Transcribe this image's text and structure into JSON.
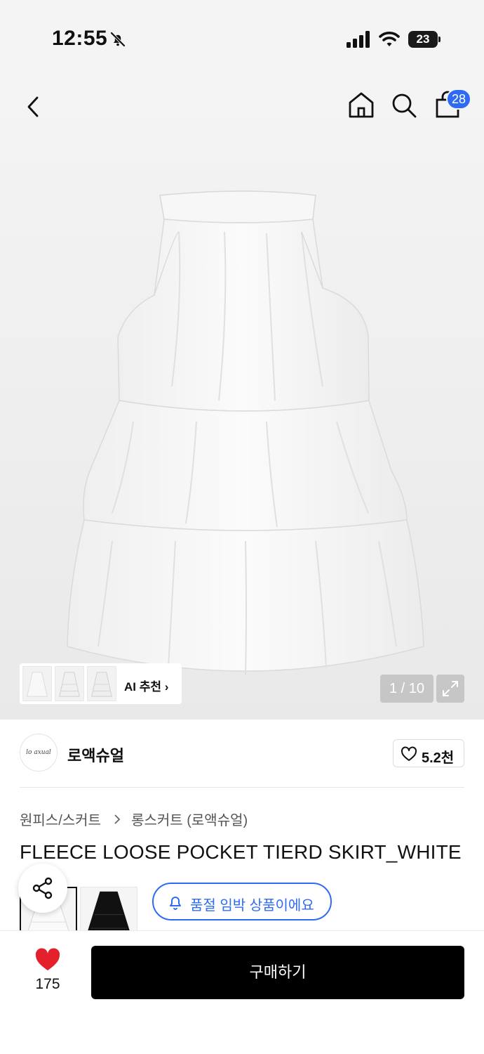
{
  "status_bar": {
    "time": "12:55",
    "battery": "23"
  },
  "nav": {
    "cart_count": "28"
  },
  "gallery": {
    "counter": "1 / 10",
    "ai_label": "AI 추천 ›"
  },
  "brand": {
    "logo_text": "lo axual",
    "name": "로액슈얼",
    "likes": "5.2천"
  },
  "breadcrumb": {
    "category": "원피스/스커트",
    "subcategory": "롱스커트 (로액슈얼)"
  },
  "product": {
    "title": "FLEECE LOOSE POCKET TIERD SKIRT_WHITE"
  },
  "notice": {
    "text": "품절 임박 상품이에요"
  },
  "bottom": {
    "wish_count": "175",
    "buy_label": "구매하기"
  },
  "colors": {
    "accent": "#2f6bf2",
    "heart": "#e3202b",
    "buy_bg": "#000000"
  }
}
